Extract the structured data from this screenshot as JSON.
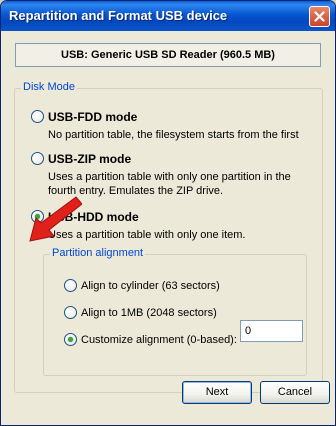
{
  "window": {
    "title": "Repartition and Format USB device"
  },
  "device": {
    "label": "USB: Generic USB  SD Reader (960.5 MB)"
  },
  "disk_mode": {
    "legend": "Disk Mode",
    "options": [
      {
        "label": "USB-FDD mode",
        "checked": false,
        "description": [
          "No partition table, the filesystem starts from the first"
        ]
      },
      {
        "label": "USB-ZIP mode",
        "checked": false,
        "description": [
          "Uses a partition table with only one partition in the",
          "fourth entry. Emulates the ZIP drive."
        ]
      },
      {
        "label": "USB-HDD mode",
        "checked": true,
        "description": [
          "Uses a partition table with only one item."
        ]
      }
    ]
  },
  "partition_alignment": {
    "legend": "Partition alignment",
    "options": [
      {
        "label": "Align to cylinder (63 sectors)",
        "checked": false
      },
      {
        "label": "Align to 1MB (2048 sectors)",
        "checked": false
      },
      {
        "label": "Customize alignment (0-based):",
        "checked": true
      }
    ],
    "custom_value": "0"
  },
  "buttons": {
    "next": "Next",
    "cancel": "Cancel"
  },
  "colors": {
    "titlebar": "#0757d0",
    "legend_text": "#0046d5",
    "arrow": "#e0201a"
  }
}
